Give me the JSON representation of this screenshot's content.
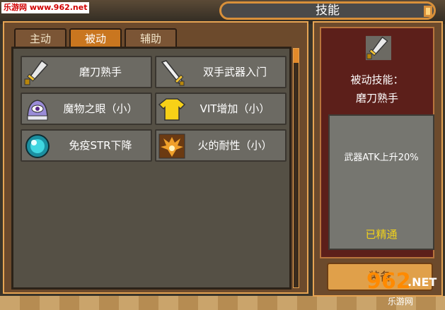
{
  "watermark": {
    "top_left": "乐游网 www.962.net",
    "bottom_right_logo": "962",
    "bottom_right_net": ".NET",
    "bottom_right_sub": "乐游网"
  },
  "title": "技能",
  "tabs": [
    {
      "label": "主动",
      "active": false
    },
    {
      "label": "被动",
      "active": true
    },
    {
      "label": "辅助",
      "active": false
    }
  ],
  "skills": [
    {
      "name": "磨刀熟手",
      "icon": "sword-icon"
    },
    {
      "name": "双手武器入门",
      "icon": "two-hand-sword-icon"
    },
    {
      "name": "魔物之眼（小）",
      "icon": "monster-eye-icon"
    },
    {
      "name": "VIT增加（小）",
      "icon": "shirt-icon"
    },
    {
      "name": "免疫STR下降",
      "icon": "orb-icon"
    },
    {
      "name": "火的耐性（小）",
      "icon": "fire-icon"
    }
  ],
  "detail": {
    "type_label": "被动技能：",
    "skill_name": "磨刀熟手",
    "description": "武器ATK上升20%",
    "status": "已精通",
    "icon": "sword-icon"
  },
  "equip_button": "装备",
  "colors": {
    "accent": "#e6a453",
    "status": "#f2d21a",
    "active_tab": "#c9761f"
  }
}
